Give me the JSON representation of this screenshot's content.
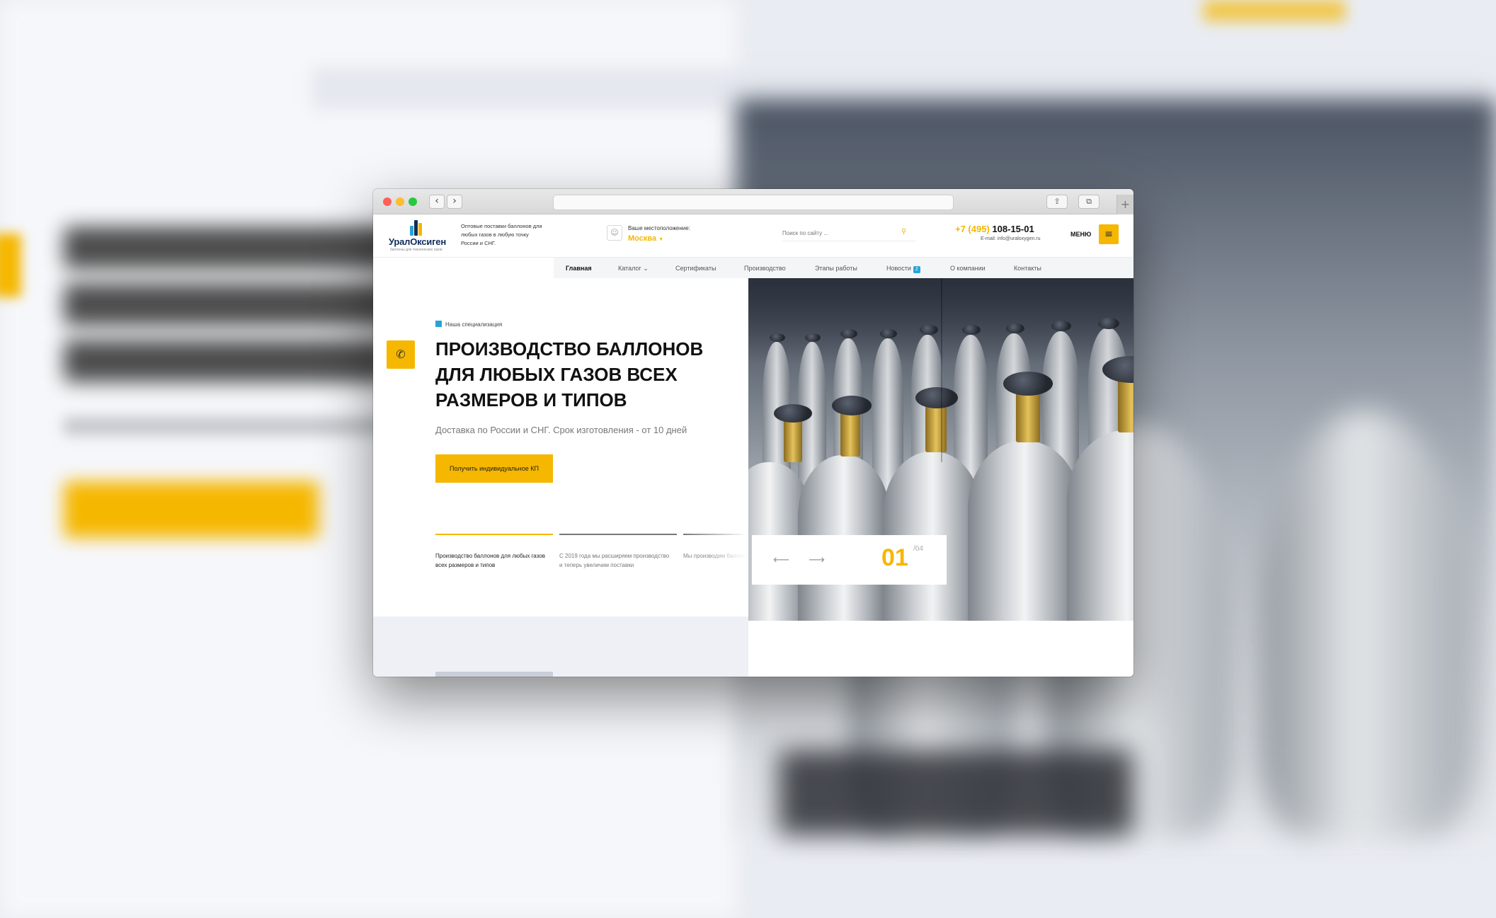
{
  "site": {
    "logo_name": "УралОксиген",
    "logo_tagline": "баллоны для технических газов",
    "header_description": "Оптовые поставки баллонов для любых газов в любую точку России и СНГ.",
    "location_label": "Ваше местоположение:",
    "location_city": "Москва",
    "search_placeholder": "Поиск по сайту ...",
    "phone_code": "+7 (495)",
    "phone_number": "108-15-01",
    "email": "E-mail: info@uraloxygen.ru",
    "menu_label": "МЕНЮ"
  },
  "nav": {
    "items": [
      {
        "label": "Главная",
        "active": true
      },
      {
        "label": "Каталог ⌄",
        "active": false
      },
      {
        "label": "Сертификаты",
        "active": false
      },
      {
        "label": "Производство",
        "active": false
      },
      {
        "label": "Этапы работы",
        "active": false
      },
      {
        "label": "Новости",
        "active": false,
        "badge": "2"
      },
      {
        "label": "О компании",
        "active": false
      },
      {
        "label": "Контакты",
        "active": false
      }
    ]
  },
  "hero": {
    "tag": "Наша специализация",
    "title": "ПРОИЗВОДСТВО БАЛЛОНОВ ДЛЯ ЛЮБЫХ ГАЗОВ ВСЕХ РАЗМЕРОВ И ТИПОВ",
    "subtitle": "Доставка по России и СНГ. Срок изготовления - от 10 дней",
    "cta_label": "Получить индивидуальное КП",
    "slides": [
      "Производство баллонов для любых газов всех размеров и типов",
      "С 2019 года мы расширяем производство и теперь увеличим поставки",
      "Мы производим баллоны для любых газов всех"
    ],
    "counter_current": "01",
    "counter_total": "/04"
  },
  "browser": {
    "back_glyph": "‹",
    "forward_glyph": "›",
    "share_glyph": "⇪",
    "tabs_glyph": "⧉",
    "plus_glyph": "+"
  },
  "icons": {
    "location": "person-pin-icon",
    "search": "search-icon",
    "menu": "hamburger-icon",
    "phone": "phone-icon",
    "arrow_left": "arrow-left-icon",
    "arrow_right": "arrow-right-icon"
  },
  "colors": {
    "accent": "#f5b700",
    "blue": "#29a3d6",
    "logo_blue": "#0f2c5c"
  }
}
